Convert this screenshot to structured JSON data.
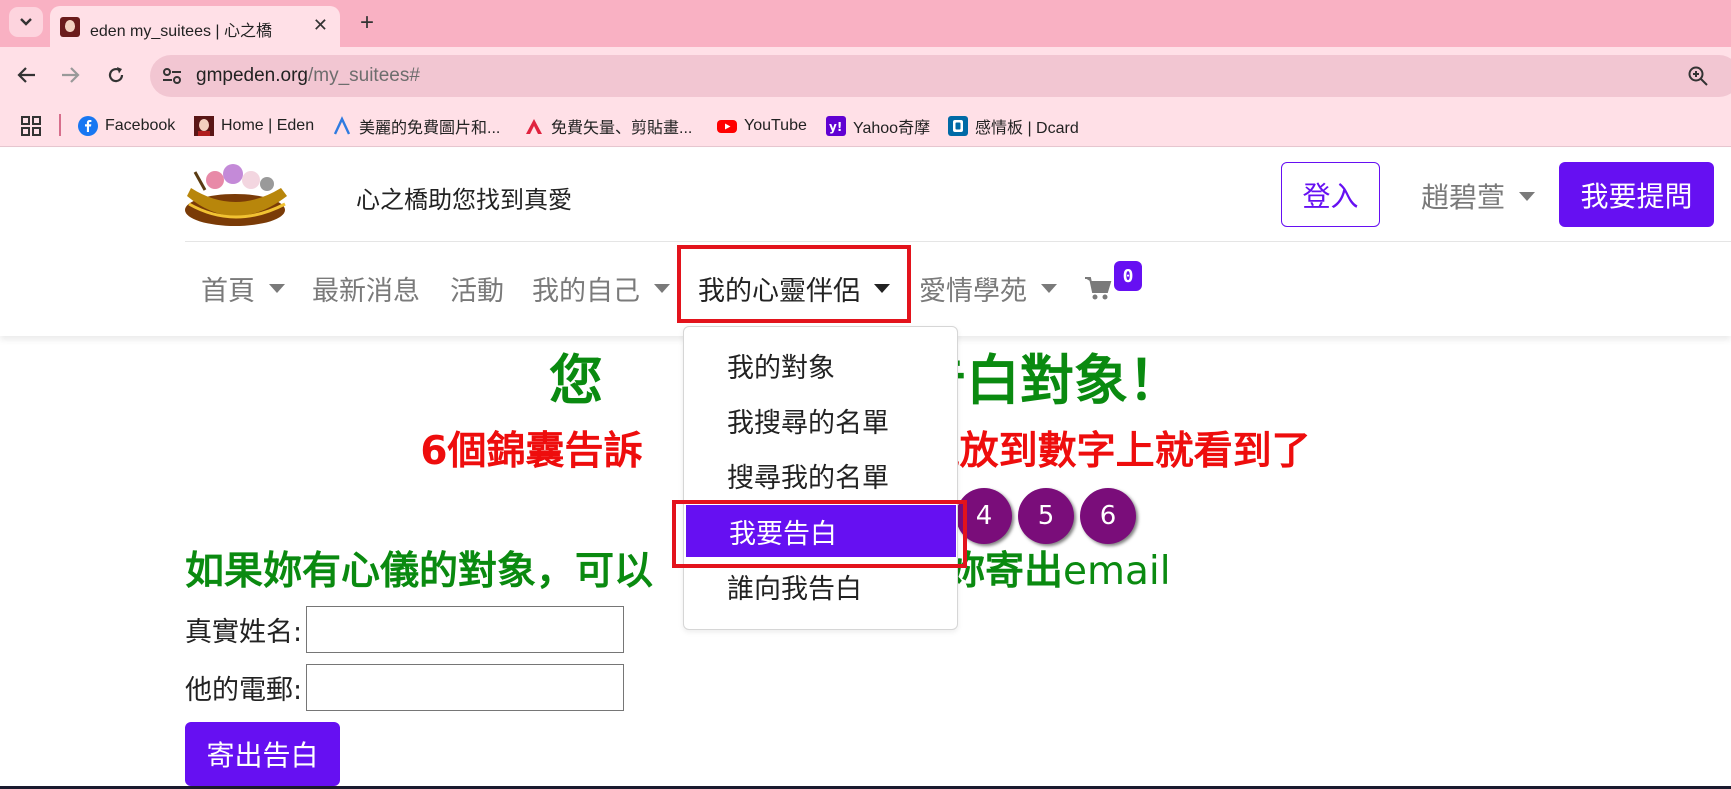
{
  "browser": {
    "tab_title": "eden my_suitees | 心之橋",
    "url_host": "gmpeden.org",
    "url_path": "/my_suitees#",
    "bookmarks": [
      {
        "label": "Facebook",
        "icon": "facebook-icon"
      },
      {
        "label": "Home | Eden",
        "icon": "eden-avatar-icon"
      },
      {
        "label": "美麗的免費圖片和...",
        "icon": "pixabay-icon"
      },
      {
        "label": "免費矢量、剪貼畫...",
        "icon": "vecteezy-icon"
      },
      {
        "label": "YouTube",
        "icon": "youtube-icon"
      },
      {
        "label": "Yahoo奇摩",
        "icon": "yahoo-icon"
      },
      {
        "label": "感情板 | Dcard",
        "icon": "dcard-icon"
      }
    ]
  },
  "header": {
    "slogan": "心之橋助您找到真愛",
    "login_label": "登入",
    "user_name": "趙碧萱",
    "ask_label": "我要提問"
  },
  "nav": {
    "items": [
      {
        "label": "首頁",
        "dropdown": true
      },
      {
        "label": "最新消息",
        "dropdown": false
      },
      {
        "label": "活動",
        "dropdown": false
      },
      {
        "label": "我的自己",
        "dropdown": true
      },
      {
        "label": "我的心靈伴侶",
        "dropdown": true,
        "active": true
      },
      {
        "label": "愛情學苑",
        "dropdown": true
      }
    ],
    "cart_count": "0"
  },
  "dropdown": {
    "items": [
      "我的對象",
      "我搜尋的名單",
      "搜尋我的名單",
      "我要告白",
      "誰向我告白"
    ],
    "active_index": 3
  },
  "main": {
    "headline_left": "您",
    "headline_right": "何告白對象！",
    "tips_left": "6個錦囊告訴",
    "tips_right": "把滑鼠放到數字上就看到了",
    "tips_numbers": [
      "4",
      "5",
      "6"
    ],
    "intro_left": "如果妳有心儀的對象，可以",
    "intro_right": "幫妳寄出",
    "intro_email": "email",
    "name_label": "真實姓名:",
    "email_label": "他的電郵:",
    "submit_label": "寄出告白"
  },
  "colors": {
    "brand": "#6610f2",
    "headline_green": "#0a8a10",
    "tips_red": "#ee0d0d",
    "highlight_red": "#e3131c",
    "tip_circle": "#7a0d7a"
  }
}
